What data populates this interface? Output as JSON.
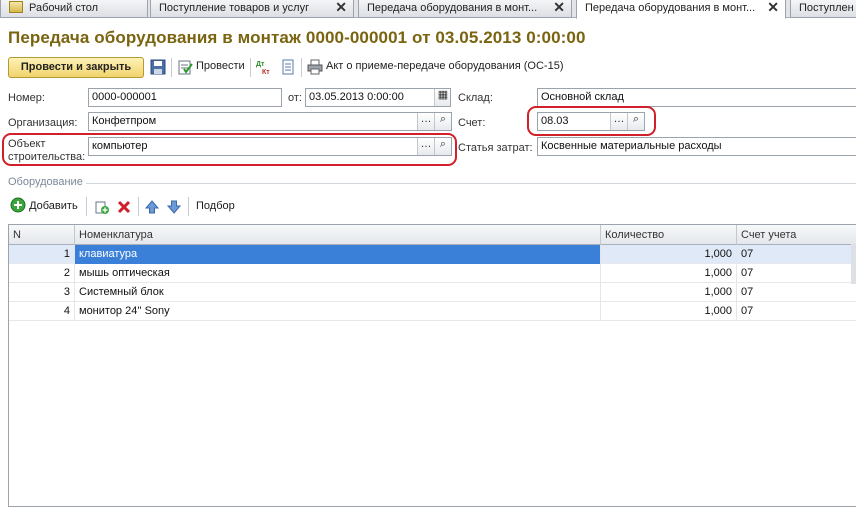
{
  "tabs": [
    {
      "label": "Рабочий стол",
      "has_close": false
    },
    {
      "label": "Поступление товаров и услуг",
      "has_close": true
    },
    {
      "label": "Передача оборудования в монт...",
      "has_close": true
    },
    {
      "label": "Передача оборудования в монт...",
      "has_close": true,
      "active": true
    },
    {
      "label": "Поступлен",
      "has_close": false
    }
  ],
  "title": "Передача оборудования в монтаж 0000-000001 от 03.05.2013 0:00:00",
  "toolbar": {
    "post_close": "Провести и закрыть",
    "post": "Провести",
    "act": "Акт о приеме-передаче оборудования (ОС-15)"
  },
  "form": {
    "number_label": "Номер:",
    "number_value": "0000-000001",
    "date_label": "от:",
    "date_value": "03.05.2013  0:00:00",
    "warehouse_label": "Склад:",
    "warehouse_value": "Основной склад",
    "org_label": "Организация:",
    "org_value": "Конфетпром",
    "account_label": "Счет:",
    "account_value": "08.03",
    "object_label_1": "Объект",
    "object_label_2": "строительства:",
    "object_value": "компьютер",
    "expense_label": "Статья затрат:",
    "expense_value": "Косвенные материальные расходы"
  },
  "section": {
    "label": "Оборудование"
  },
  "table_toolbar": {
    "add": "Добавить",
    "pick": "Подбор"
  },
  "table": {
    "columns": [
      "N",
      "Номенклатура",
      "Количество",
      "Счет учета"
    ],
    "rows": [
      {
        "n": "1",
        "name": "клавиатура",
        "qty": "1,000",
        "acc": "07",
        "selected": true
      },
      {
        "n": "2",
        "name": "мышь оптическая",
        "qty": "1,000",
        "acc": "07"
      },
      {
        "n": "3",
        "name": "Системный блок",
        "qty": "1,000",
        "acc": "07"
      },
      {
        "n": "4",
        "name": "монитор 24'' Sony",
        "qty": "1,000",
        "acc": "07"
      }
    ]
  },
  "colors": {
    "title": "#7a6410",
    "highlight_ring": "#d0202a",
    "selection": "#3a7fd8",
    "primary_button": "#f0d36c"
  },
  "icons": [
    "desktop-icon",
    "close-icon",
    "save-icon",
    "post-icon",
    "dt-kt-icon",
    "report-icon",
    "print-icon",
    "ellipsis-icon",
    "search-icon",
    "calendar-icon",
    "add-icon",
    "copy-icon",
    "delete-icon",
    "arrow-up-icon",
    "arrow-down-icon"
  ]
}
